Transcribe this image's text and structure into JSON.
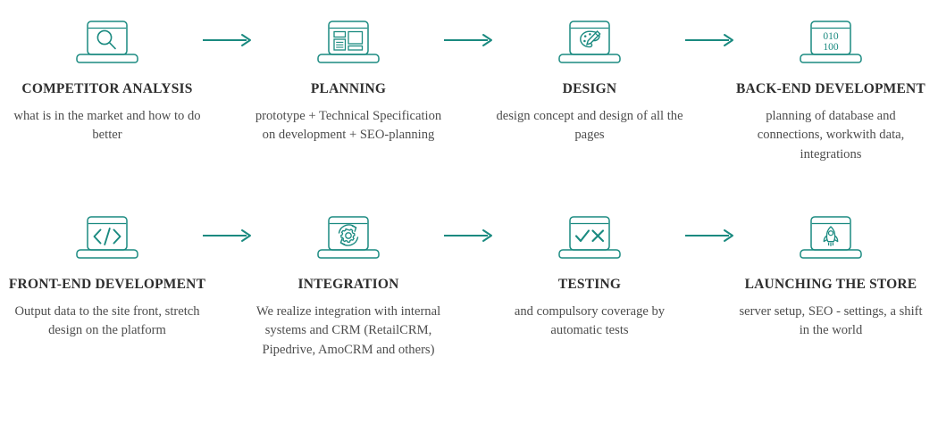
{
  "diagram": {
    "type": "process-flow",
    "accent_color": "#1a8a80",
    "title_color": "#2e2e2e",
    "body_color": "#4d4d4d",
    "background_color": "#ffffff",
    "arrow_label": "arrow-right"
  },
  "rows": [
    {
      "steps": [
        {
          "icon": "laptop-search-icon",
          "title": "COMPETITOR ANALYSIS",
          "desc": "what is in the market and how to do better"
        },
        {
          "icon": "laptop-wireframe-icon",
          "title": "PLANNING",
          "desc": "prototype + Technical Specification on development + SEO-planning"
        },
        {
          "icon": "laptop-palette-brush-icon",
          "title": "DESIGN",
          "desc": "design concept and design of all the pages"
        },
        {
          "icon": "laptop-binary-icon",
          "title": "BACK-END DEVELOPMENT",
          "desc": "planning of database and connections, workwith data, integrations",
          "binary_top": "010",
          "binary_bottom": "100"
        }
      ]
    },
    {
      "steps": [
        {
          "icon": "laptop-code-tags-icon",
          "title": "FRONT-END DEVELOPMENT",
          "desc": "Output data to the site front, stretch design on the platform",
          "code_glyph": "</>"
        },
        {
          "icon": "laptop-gear-sync-icon",
          "title": "INTEGRATION",
          "desc": "We realize integration with internal systems and CRM (RetailCRM, Pipedrive, AmoCRM and others)"
        },
        {
          "icon": "laptop-check-cross-icon",
          "title": "TESTING",
          "desc": "and compulsory coverage by automatic tests"
        },
        {
          "icon": "laptop-rocket-icon",
          "title": "LAUNCHING THE STORE",
          "desc": "server setup, SEO - settings, a shift in the world"
        }
      ]
    }
  ]
}
